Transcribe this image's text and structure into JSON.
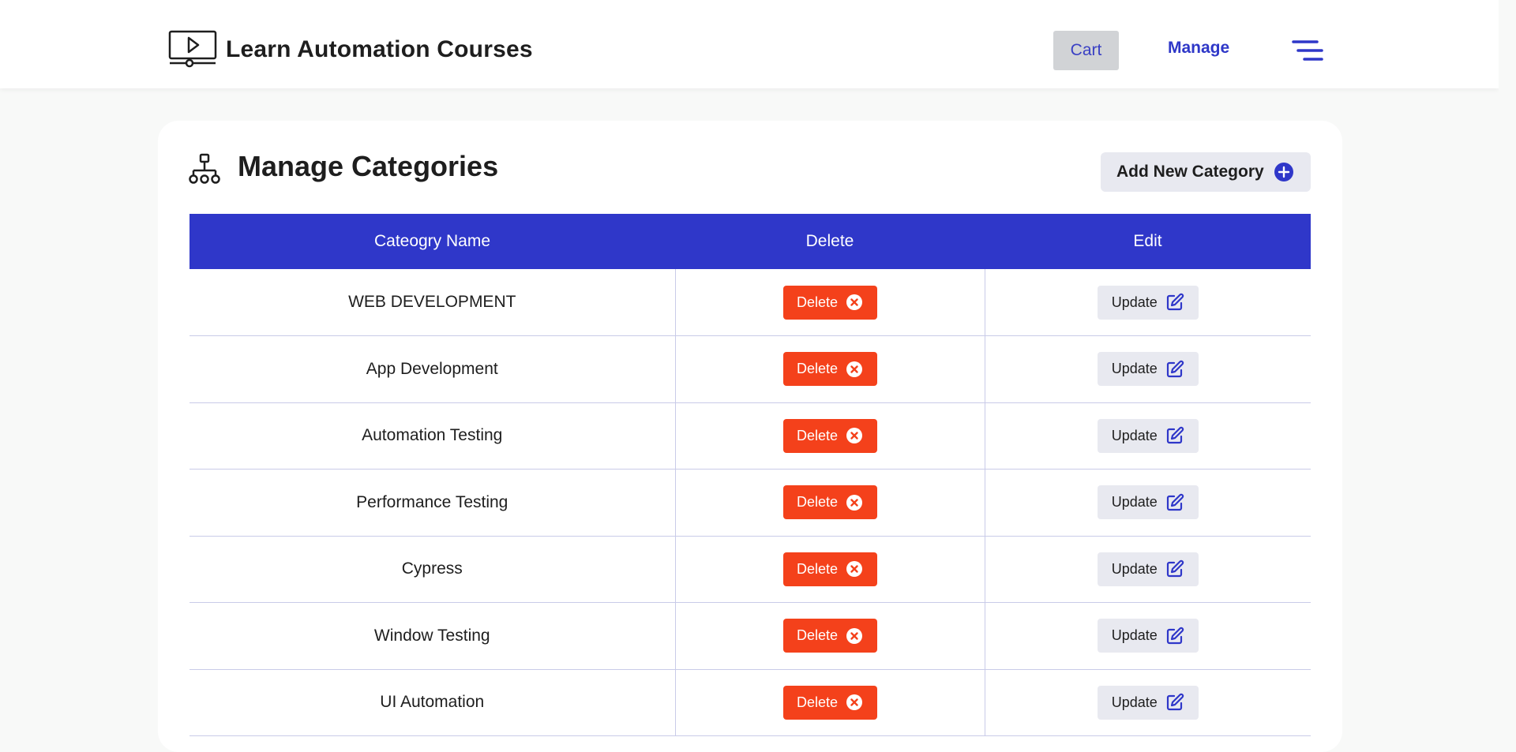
{
  "header": {
    "brand_title": "Learn Automation Courses",
    "cart_label": "Cart",
    "manage_label": "Manage"
  },
  "section": {
    "title": "Manage Categories",
    "add_button_label": "Add New Category"
  },
  "table": {
    "columns": [
      "Cateogry Name",
      "Delete",
      "Edit"
    ],
    "rows": [
      {
        "name": "WEB DEVELOPMENT",
        "delete_label": "Delete",
        "update_label": "Update"
      },
      {
        "name": "App Development",
        "delete_label": "Delete",
        "update_label": "Update"
      },
      {
        "name": "Automation Testing",
        "delete_label": "Delete",
        "update_label": "Update"
      },
      {
        "name": "Performance Testing",
        "delete_label": "Delete",
        "update_label": "Update"
      },
      {
        "name": "Cypress",
        "delete_label": "Delete",
        "update_label": "Update"
      },
      {
        "name": "Window Testing",
        "delete_label": "Delete",
        "update_label": "Update"
      },
      {
        "name": "UI Automation",
        "delete_label": "Delete",
        "update_label": "Update"
      }
    ]
  },
  "icons": {
    "logo": "monitor-play-icon",
    "menu": "hamburger-menu-icon",
    "section": "hierarchy-icon",
    "add": "plus-circle-icon",
    "delete": "close-circle-icon",
    "update": "edit-icon"
  },
  "colors": {
    "accent": "#2f37c9",
    "danger": "#f4411b",
    "button_gray": "#e8e9f0",
    "cart_bg": "#d1d3d6"
  }
}
